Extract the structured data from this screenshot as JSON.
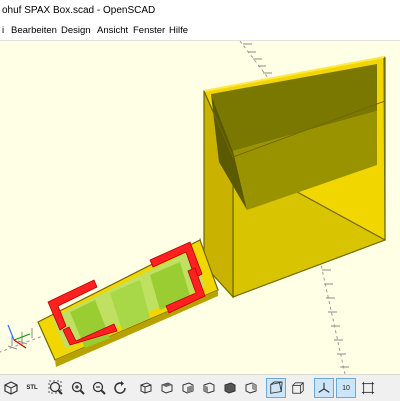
{
  "window": {
    "title": "ohuf SPAX Box.scad - OpenSCAD"
  },
  "menu": {
    "items": [
      {
        "label": "i"
      },
      {
        "label": "Bearbeiten"
      },
      {
        "label": "Design"
      },
      {
        "label": "Ansicht"
      },
      {
        "label": "Fenster"
      },
      {
        "label": "Hilfe"
      }
    ]
  },
  "toolbar": {
    "stl_label": "STL",
    "axes_label_10": "10",
    "icons": [
      "preview-icon",
      "render-icon",
      "export-stl-icon",
      "view-all-icon",
      "zoom-in-icon",
      "zoom-out-icon",
      "reset-view-icon",
      "view-right-icon",
      "view-top-icon",
      "view-bottom-icon",
      "view-left-icon",
      "view-front-icon",
      "view-back-icon",
      "perspective-icon",
      "orthogonal-icon",
      "show-axes-icon",
      "show-scale-markers-icon",
      "show-edges-icon"
    ]
  },
  "colors": {
    "background": "#ffffe5",
    "model_yellow": "#f2d600",
    "model_dark": "#7a7a00",
    "accent_red": "#ff2020",
    "green": "#9acd32"
  }
}
